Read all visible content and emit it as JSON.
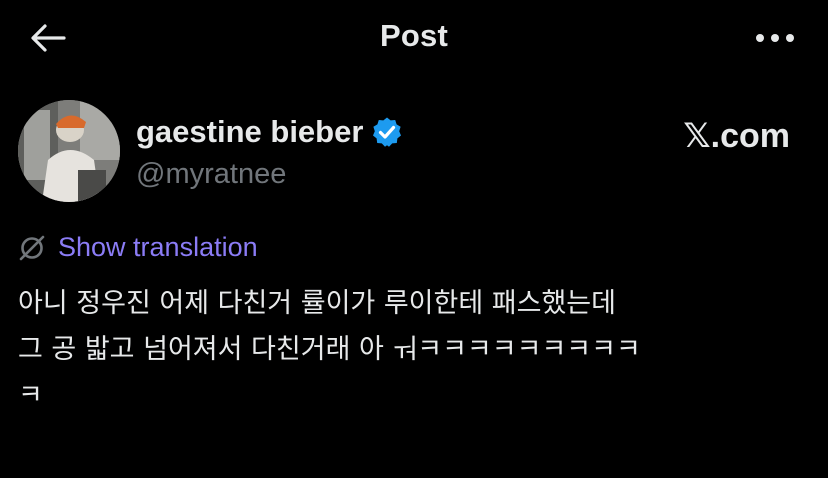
{
  "header": {
    "title": "Post",
    "back_icon": "arrow-left-icon",
    "more_icon": "more-horizontal-icon"
  },
  "author": {
    "display_name": "gaestine bieber",
    "handle": "@myratnee",
    "verified_icon": "verified-badge-icon",
    "verified_color": "#1d9bf0"
  },
  "brand": {
    "text": "𝕏.com"
  },
  "translation": {
    "label": "Show translation",
    "icon": "globe-slash-icon",
    "color": "#8b7cf6"
  },
  "post": {
    "text": "아니 정우진 어제 다친거 률이가 루이한테 패스했는데\n그 공 밟고 넘어져서 다친거래 아 ㅝㅋㅋㅋㅋㅋㅋㅋㅋㅋ\nㅋ"
  },
  "colors": {
    "background": "#000000",
    "text": "#e7e9ea",
    "secondary": "#71767b"
  }
}
